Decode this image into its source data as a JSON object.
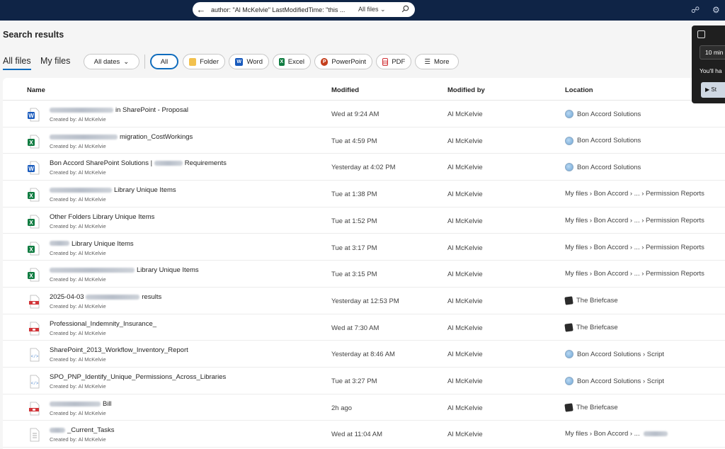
{
  "search": {
    "query": "author: \"Al McKelvie\" LastModifiedTime: \"this ...",
    "scope": "All files"
  },
  "page_title": "Search results",
  "tabs": [
    "All files",
    "My files"
  ],
  "filters": {
    "dates": "All dates",
    "all": "All",
    "folder": "Folder",
    "word": "Word",
    "excel": "Excel",
    "powerpoint": "PowerPoint",
    "pdf": "PDF",
    "more": "More"
  },
  "columns": {
    "name": "Name",
    "modified": "Modified",
    "modified_by": "Modified by",
    "location": "Location"
  },
  "created_prefix": "Created by: Al McKelvie",
  "rows": [
    {
      "type": "word",
      "name_suffix": "in SharePoint - Proposal",
      "modified": "Wed at 9:24 AM",
      "modified_by": "Al McKelvie",
      "location": "Bon Accord Solutions"
    },
    {
      "type": "excel",
      "name_suffix": "migration_CostWorkings",
      "modified": "Tue at 4:59 PM",
      "modified_by": "Al McKelvie",
      "location": "Bon Accord Solutions"
    },
    {
      "type": "word",
      "name_prefix": "Bon Accord SharePoint Solutions |",
      "name_suffix": "Requirements",
      "modified": "Yesterday at 4:02 PM",
      "modified_by": "Al McKelvie",
      "location": "Bon Accord Solutions"
    },
    {
      "type": "excel",
      "name_suffix": "Library Unique Items",
      "modified": "Tue at 1:38 PM",
      "modified_by": "Al McKelvie",
      "location": "My files > Bon Accord > ... > Permission Reports"
    },
    {
      "type": "excel",
      "name_prefix": "Other Folders Library Unique Items",
      "modified": "Tue at 1:52 PM",
      "modified_by": "Al McKelvie",
      "location": "My files > Bon Accord > ... > Permission Reports"
    },
    {
      "type": "excel",
      "name_suffix": "Library Unique Items",
      "modified": "Tue at 3:17 PM",
      "modified_by": "Al McKelvie",
      "location": "My files > Bon Accord > ... > Permission Reports"
    },
    {
      "type": "excel",
      "name_suffix": "Library Unique Items",
      "modified": "Tue at 3:15 PM",
      "modified_by": "Al McKelvie",
      "location": "My files > Bon Accord > ... > Permission Reports"
    },
    {
      "type": "pdf",
      "name_prefix": "2025-04-03",
      "name_suffix": "results",
      "modified": "Yesterday at 12:53 PM",
      "modified_by": "Al McKelvie",
      "location": "The Briefcase"
    },
    {
      "type": "pdf",
      "name_prefix": "Professional_Indemnity_Insurance_",
      "modified": "Wed at 7:30 AM",
      "modified_by": "Al McKelvie",
      "location": "The Briefcase"
    },
    {
      "type": "code",
      "name_prefix": "SharePoint_2013_Workflow_Inventory_Report",
      "modified": "Yesterday at 8:46 AM",
      "modified_by": "Al McKelvie",
      "location": "Bon Accord Solutions > Script"
    },
    {
      "type": "code",
      "name_prefix": "SPO_PNP_Identify_Unique_Permissions_Across_Libraries",
      "modified": "Tue at 3:27 PM",
      "modified_by": "Al McKelvie",
      "location": "Bon Accord Solutions > Script"
    },
    {
      "type": "pdf",
      "name_suffix": "Bill",
      "modified": "2h ago",
      "modified_by": "Al McKelvie",
      "location": "The Briefcase"
    },
    {
      "type": "text",
      "name_suffix": "_Current_Tasks",
      "modified": "Wed at 11:04 AM",
      "modified_by": "Al McKelvie",
      "location": "My files > Bon Accord > ..."
    }
  ],
  "panel": {
    "minutes": "10 min",
    "message": "You'll ha",
    "start": "St"
  },
  "colors": {
    "topbar": "#0f2446",
    "accent": "#0f6cbd",
    "word": "#185abd",
    "excel": "#107c41",
    "powerpoint": "#c43e1c",
    "pdf": "#d13438"
  }
}
